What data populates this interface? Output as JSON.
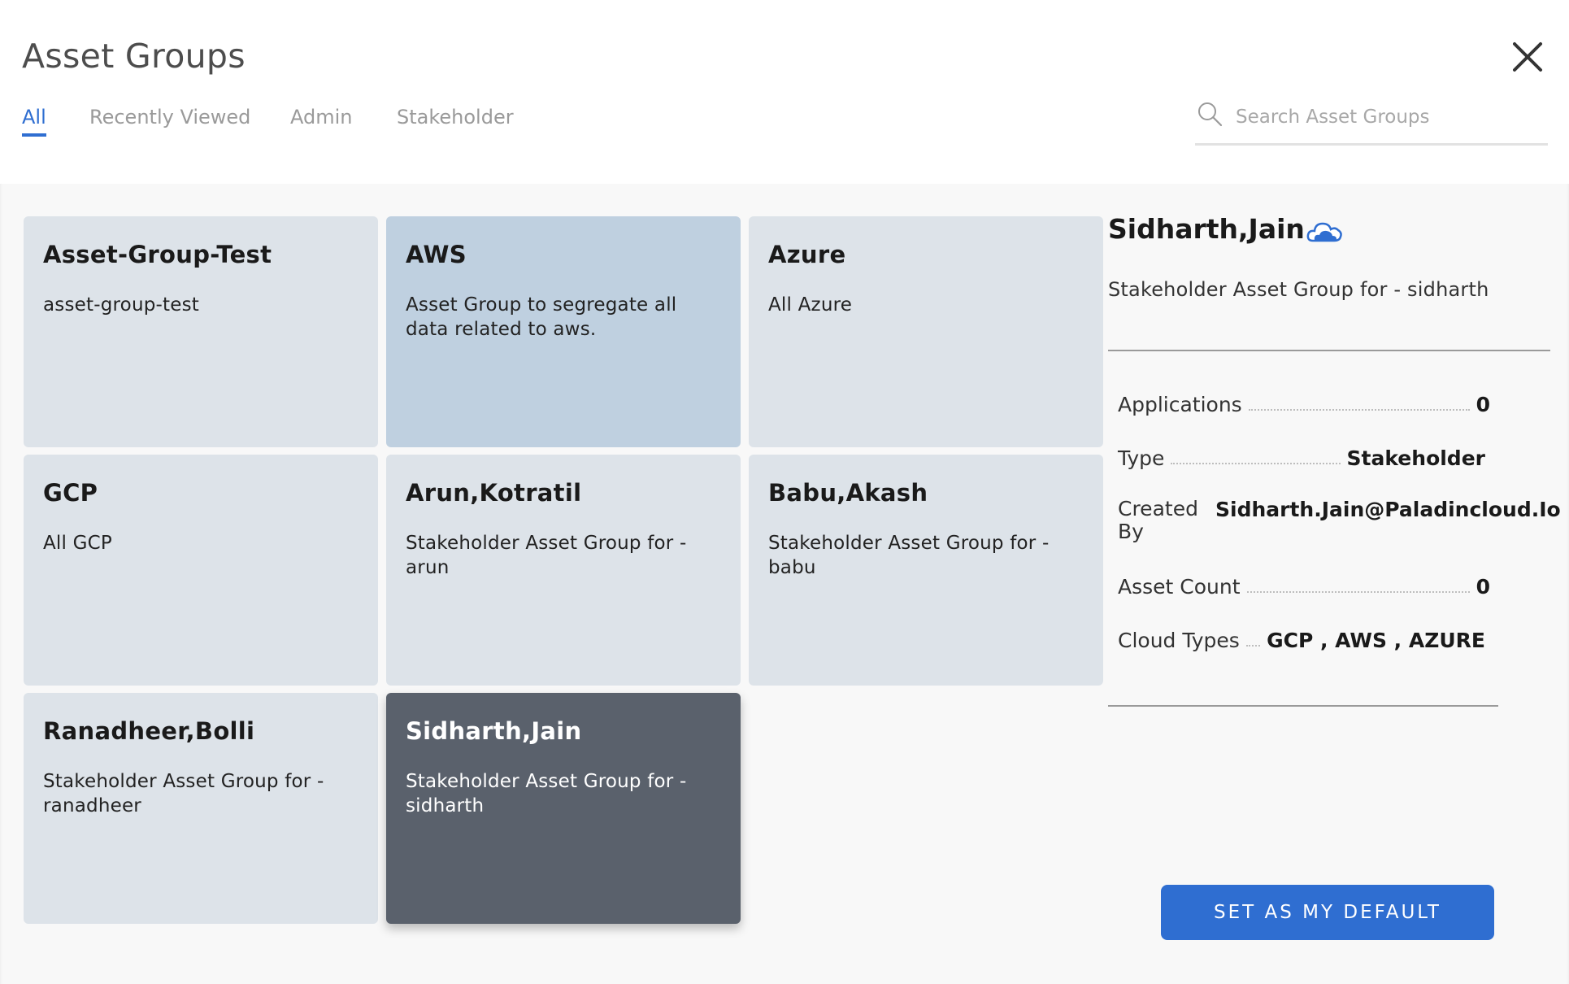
{
  "header": {
    "title": "Asset Groups",
    "tabs": [
      {
        "label": "All",
        "active": true
      },
      {
        "label": "Recently Viewed",
        "active": false
      },
      {
        "label": "Admin",
        "active": false
      },
      {
        "label": "Stakeholder",
        "active": false
      }
    ],
    "search": {
      "placeholder": "Search Asset Groups",
      "value": ""
    }
  },
  "cards": [
    {
      "title": "Asset-Group-Test",
      "description": "asset-group-test",
      "state": "default"
    },
    {
      "title": "AWS",
      "description": "Asset Group to segregate all data related to aws.",
      "state": "hover"
    },
    {
      "title": "Azure",
      "description": "All Azure",
      "state": "default"
    },
    {
      "title": "GCP",
      "description": "All GCP",
      "state": "default"
    },
    {
      "title": "Arun,Kotratil",
      "description": "Stakeholder Asset Group for - arun",
      "state": "default"
    },
    {
      "title": "Babu,Akash",
      "description": "Stakeholder Asset Group for - babu",
      "state": "default"
    },
    {
      "title": "Ranadheer,Bolli",
      "description": "Stakeholder Asset Group for - ranadheer",
      "state": "default"
    },
    {
      "title": "Sidharth,Jain",
      "description": "Stakeholder Asset Group for - sidharth",
      "state": "selected"
    }
  ],
  "detail": {
    "title": "Sidharth,Jain",
    "icon": "cloud-icon",
    "description": "Stakeholder Asset Group for - sidharth",
    "fields": {
      "applications": {
        "label": "Applications",
        "value": "0"
      },
      "type": {
        "label": "Type",
        "value": "Stakeholder"
      },
      "created_by": {
        "label": "Created By",
        "value": "Sidharth.Jain@Paladincloud.Io"
      },
      "asset_count": {
        "label": "Asset Count",
        "value": "0"
      },
      "cloud_types": {
        "label": "Cloud Types",
        "value": "GCP , AWS , AZURE"
      }
    },
    "default_button_label": "SET AS MY DEFAULT"
  },
  "colors": {
    "accent": "#2f6ed1",
    "card_default": "#dde3e9",
    "card_hover": "#bfd0e0",
    "card_selected": "#5a616c"
  }
}
